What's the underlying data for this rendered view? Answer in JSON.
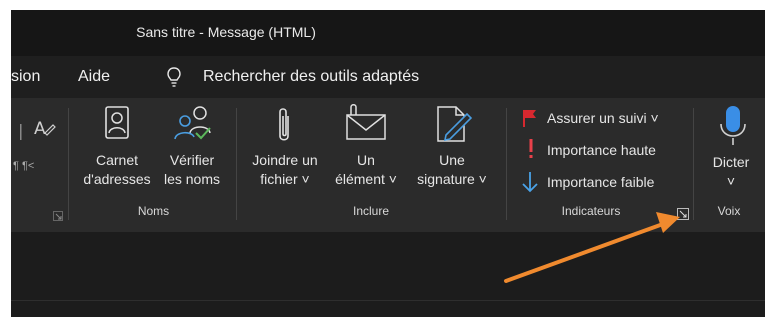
{
  "window": {
    "title": "Sans titre  -  Message (HTML)"
  },
  "menu": {
    "items": [
      "sion",
      "Aide"
    ],
    "search_label": "Rechercher des outils adaptés"
  },
  "ribbon": {
    "groups": {
      "noms": {
        "label": "Noms",
        "buttons": {
          "carnet": {
            "line1": "Carnet",
            "line2": "d'adresses"
          },
          "verifier": {
            "line1": "Vérifier",
            "line2": "les noms"
          }
        }
      },
      "inclure": {
        "label": "Inclure",
        "buttons": {
          "joindre": {
            "line1": "Joindre un",
            "line2": "fichier ˅"
          },
          "element": {
            "line1": "Un",
            "line2": "élément ˅"
          },
          "signature": {
            "line1": "Une",
            "line2": "signature ˅"
          }
        }
      },
      "indicateurs": {
        "label": "Indicateurs",
        "items": {
          "suivi": "Assurer un suivi ˅",
          "haute": "Importance haute",
          "faible": "Importance faible"
        }
      },
      "voix": {
        "label": "Voix",
        "buttons": {
          "dicter": {
            "line1": "Dicter",
            "line2": "˅"
          }
        }
      }
    },
    "partial_left": {
      "glyphs": "¶   ¶<"
    }
  },
  "colors": {
    "flag": "#d7282f",
    "importance_high": "#e8404a",
    "importance_low": "#4aa3e8",
    "mic": "#3a8ee6",
    "arrow": "#f08a2e"
  },
  "icons": {
    "menu_search": "lightbulb-icon",
    "carnet": "address-book-icon",
    "verifier": "check-names-icon",
    "joindre": "paperclip-icon",
    "element": "envelope-attach-icon",
    "signature": "signature-pen-icon",
    "suivi": "flag-icon",
    "haute": "exclamation-icon",
    "faible": "down-arrow-icon",
    "dicter": "microphone-icon",
    "launcher": "dialog-launcher-icon",
    "annotation": "orange-arrow-annotation"
  }
}
